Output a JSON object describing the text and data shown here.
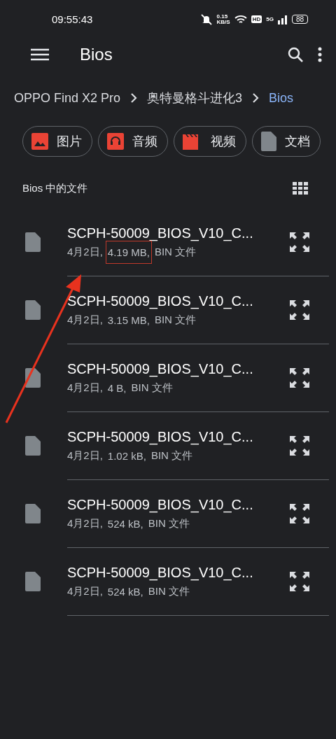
{
  "status_bar": {
    "time": "09:55:43",
    "speed": "0.15",
    "speed_unit": "KB/S",
    "hd": "HD",
    "network": "5G",
    "battery": "88"
  },
  "toolbar": {
    "title": "Bios"
  },
  "breadcrumbs": [
    {
      "label": "OPPO Find X2 Pro",
      "selected": false
    },
    {
      "label": "奥特曼格斗进化3",
      "selected": false
    },
    {
      "label": "Bios",
      "selected": true
    }
  ],
  "chips": [
    {
      "label": "图片",
      "kind": "image"
    },
    {
      "label": "音频",
      "kind": "audio"
    },
    {
      "label": "视频",
      "kind": "video"
    },
    {
      "label": "文档",
      "kind": "document"
    }
  ],
  "section": {
    "title": "Bios 中的文件"
  },
  "files": [
    {
      "name": "SCPH-50009_BIOS_V10_C...",
      "date": "4月2日,",
      "size": "4.19 MB,",
      "type": "BIN 文件",
      "highlight": true
    },
    {
      "name": "SCPH-50009_BIOS_V10_C...",
      "date": "4月2日,",
      "size": "3.15 MB,",
      "type": "BIN 文件",
      "highlight": false
    },
    {
      "name": "SCPH-50009_BIOS_V10_C...",
      "date": "4月2日,",
      "size": "4 B,",
      "type": "BIN 文件",
      "highlight": false
    },
    {
      "name": "SCPH-50009_BIOS_V10_C...",
      "date": "4月2日,",
      "size": "1.02 kB,",
      "type": "BIN 文件",
      "highlight": false
    },
    {
      "name": "SCPH-50009_BIOS_V10_C...",
      "date": "4月2日,",
      "size": "524 kB,",
      "type": "BIN 文件",
      "highlight": false
    },
    {
      "name": "SCPH-50009_BIOS_V10_C...",
      "date": "4月2日,",
      "size": "524 kB,",
      "type": "BIN 文件",
      "highlight": false
    }
  ]
}
